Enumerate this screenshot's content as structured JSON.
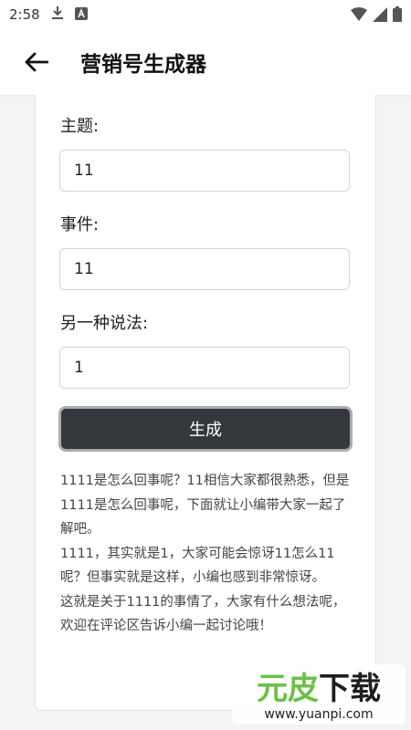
{
  "status_bar": {
    "time": "2:58",
    "left_icons": [
      "download-icon",
      "app-notification-icon"
    ],
    "right_icons": [
      "wifi-icon",
      "signal-icon",
      "battery-icon"
    ]
  },
  "app_bar": {
    "back_icon": "arrow-left-icon",
    "title": "营销号生成器"
  },
  "form": {
    "subject_label": "主题:",
    "subject_value": "11",
    "event_label": "事件:",
    "event_value": "11",
    "alt_label": "另一种说法:",
    "alt_value": "1",
    "generate_label": "生成"
  },
  "result_text": "1111是怎么回事呢？11相信大家都很熟悉，但是1111是怎么回事呢，下面就让小编带大家一起了解吧。\n1111，其实就是1，大家可能会惊讶11怎么11呢？但事实就是这样，小编也感到非常惊讶。\n这就是关于1111的事情了，大家有什么想法呢，欢迎在评论区告诉小编一起讨论哦！",
  "watermark": {
    "brand": "元皮下载",
    "url": "www.yuanpi.com",
    "colors": {
      "green": "#6cc04a",
      "dark": "#1e1e1e"
    }
  }
}
